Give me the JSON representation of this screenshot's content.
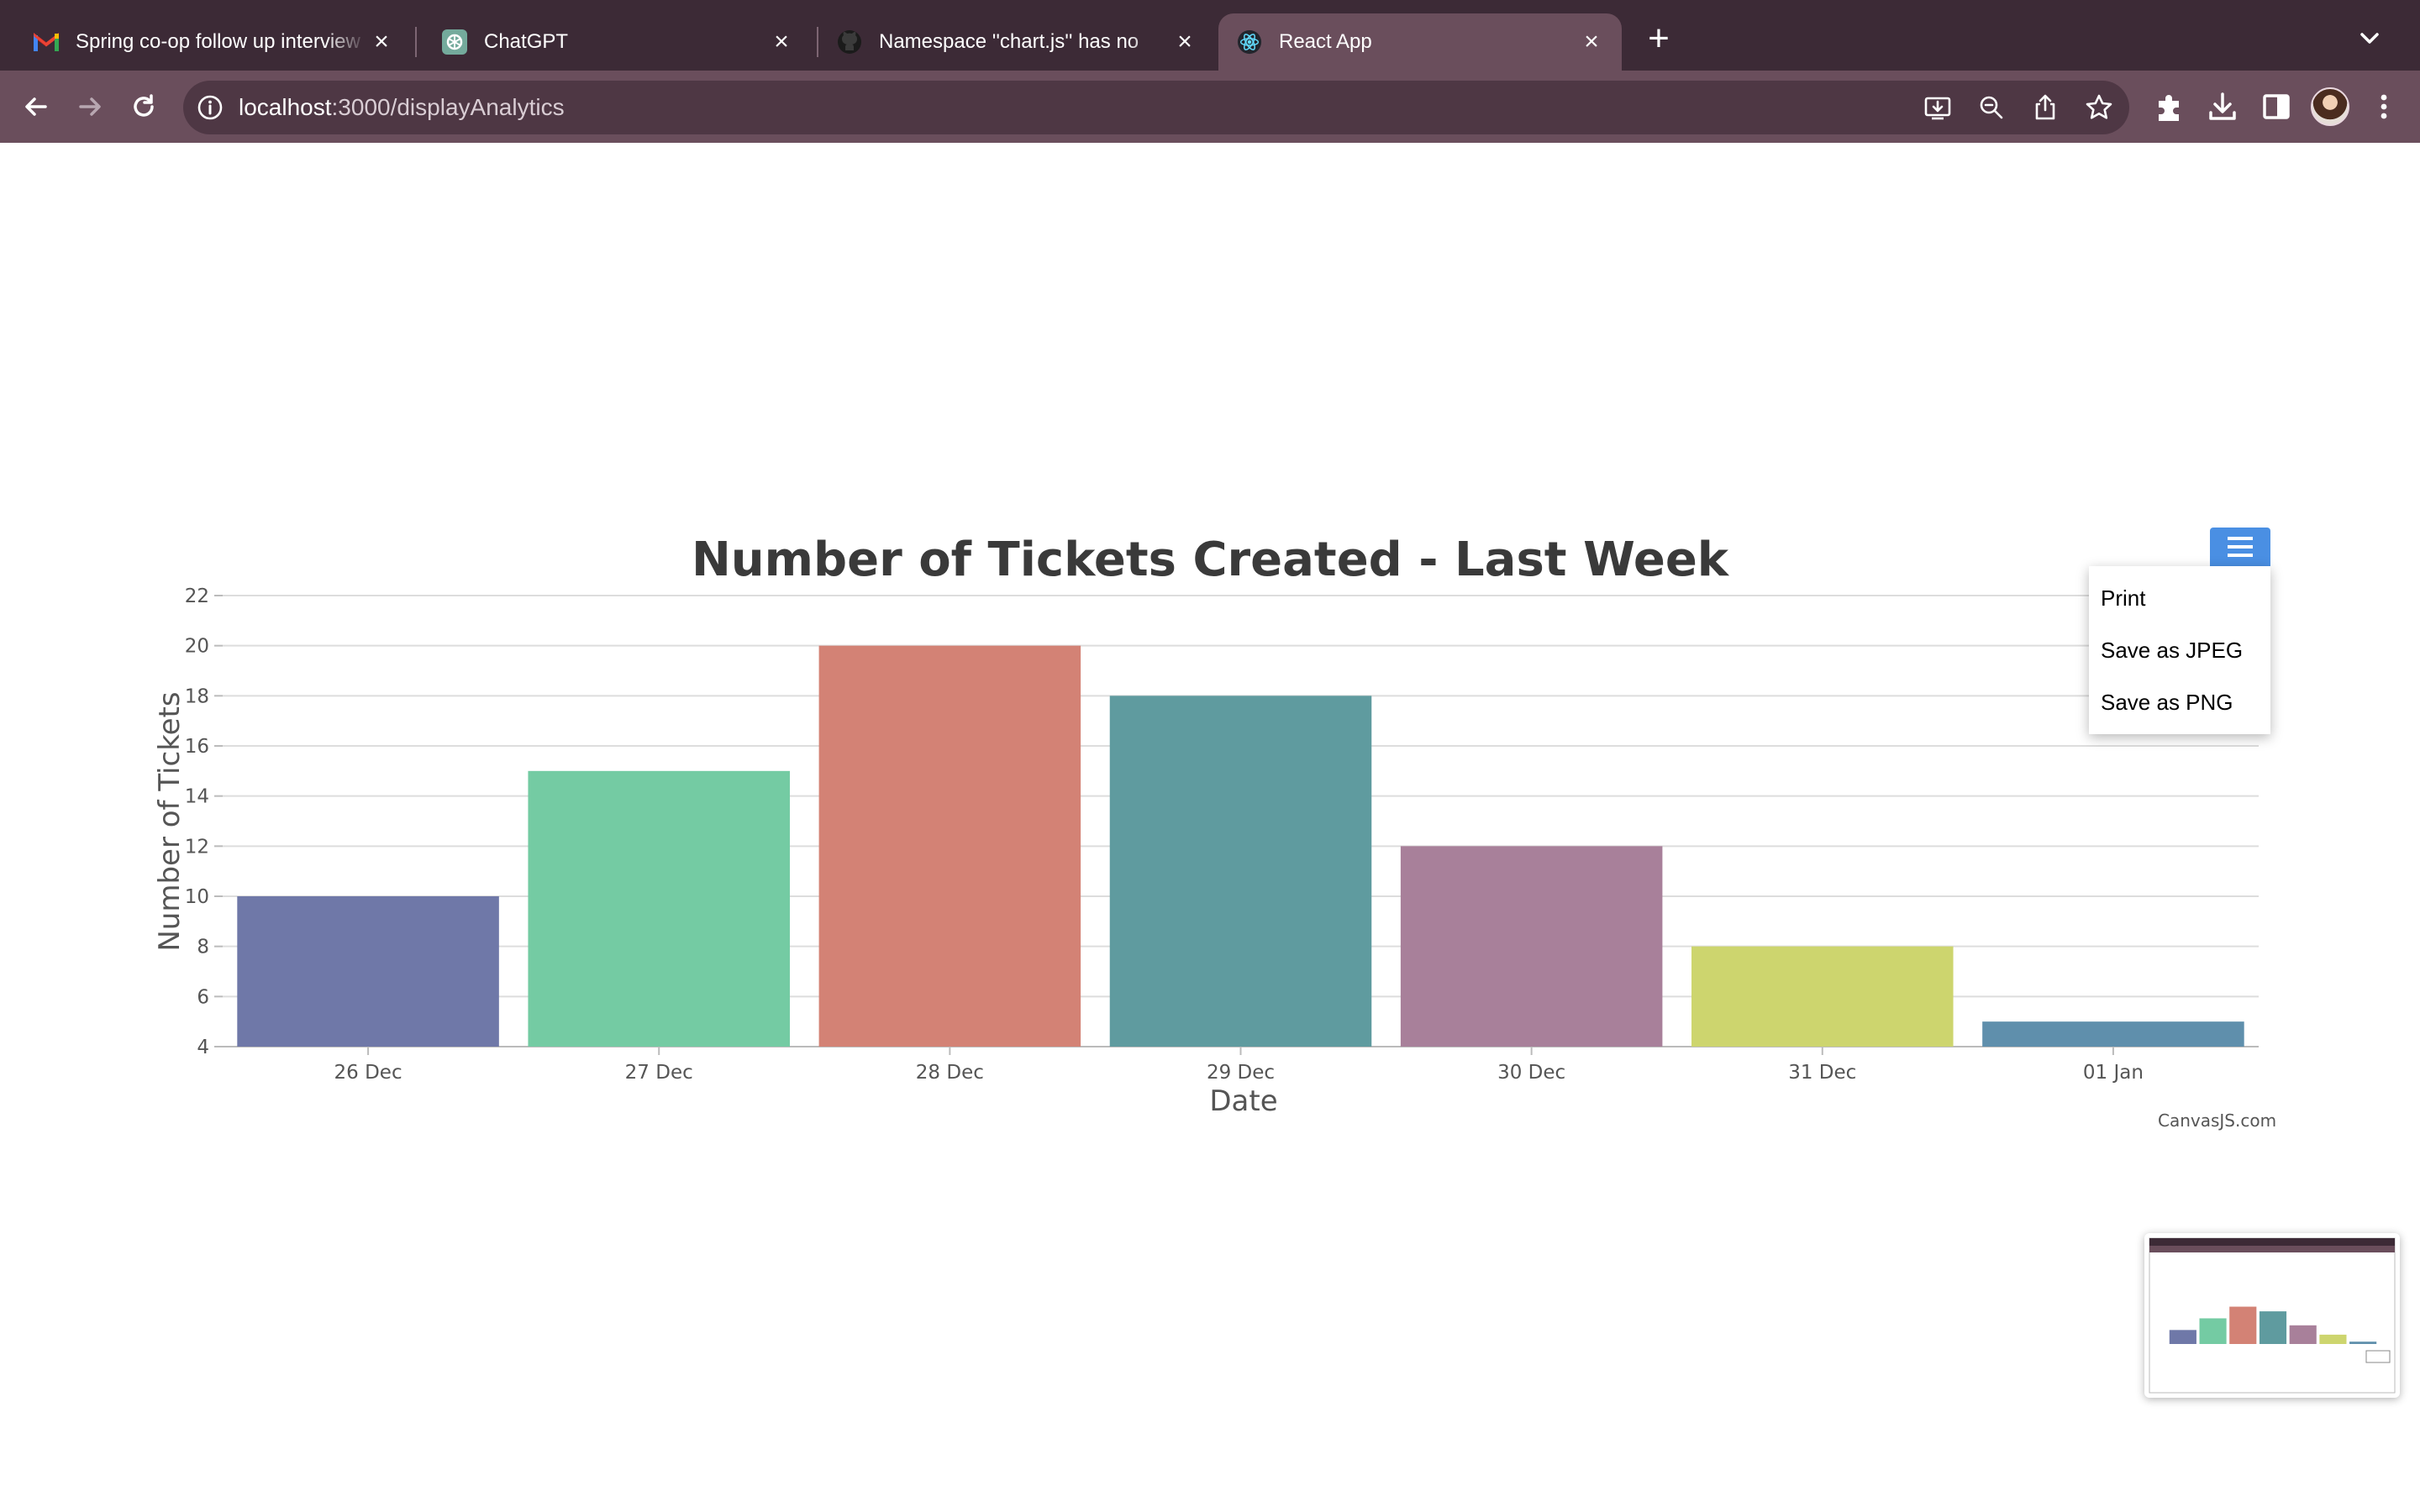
{
  "tabs": [
    {
      "title": "Spring co-op follow up interview",
      "icon": "gmail-icon",
      "active": false
    },
    {
      "title": "ChatGPT",
      "icon": "chatgpt-icon",
      "active": false
    },
    {
      "title": "Namespace ''chart.js'' has no",
      "icon": "github-icon",
      "active": false
    },
    {
      "title": "React App",
      "icon": "react-icon",
      "active": true
    }
  ],
  "address_bar": {
    "host": "localhost",
    "path": ":3000/displayAnalytics"
  },
  "toolbar_icons": [
    "back-icon",
    "forward-icon",
    "reload-icon",
    "install-app-icon",
    "zoom-icon",
    "share-icon",
    "bookmark-star-icon",
    "extensions-icon",
    "download-icon",
    "side-panel-icon",
    "profile-avatar",
    "more-menu-icon"
  ],
  "colors": {
    "chrome_dark": "#3c2a36",
    "chrome_toolbar": "#6a4e5c",
    "menu_button": "#4a8fe3"
  },
  "export_menu": {
    "items": [
      "Print",
      "Save as JPEG",
      "Save as PNG"
    ]
  },
  "credit": "CanvasJS.com",
  "chart_data": {
    "type": "bar",
    "title": "Number of Tickets Created - Last Week",
    "xlabel": "Date",
    "ylabel": "Number of Tickets",
    "categories": [
      "26 Dec",
      "27 Dec",
      "28 Dec",
      "29 Dec",
      "30 Dec",
      "31 Dec",
      "01 Jan"
    ],
    "values": [
      10,
      15,
      20,
      18,
      12,
      8,
      5
    ],
    "colors": [
      "#6f78a8",
      "#74cba3",
      "#d38275",
      "#5f9b9f",
      "#a8809a",
      "#cdd56e",
      "#5f8fac"
    ],
    "ylim": [
      4,
      22
    ],
    "yticks": [
      4,
      6,
      8,
      10,
      12,
      14,
      16,
      18,
      20,
      22
    ],
    "grid": true,
    "legend": "none"
  }
}
